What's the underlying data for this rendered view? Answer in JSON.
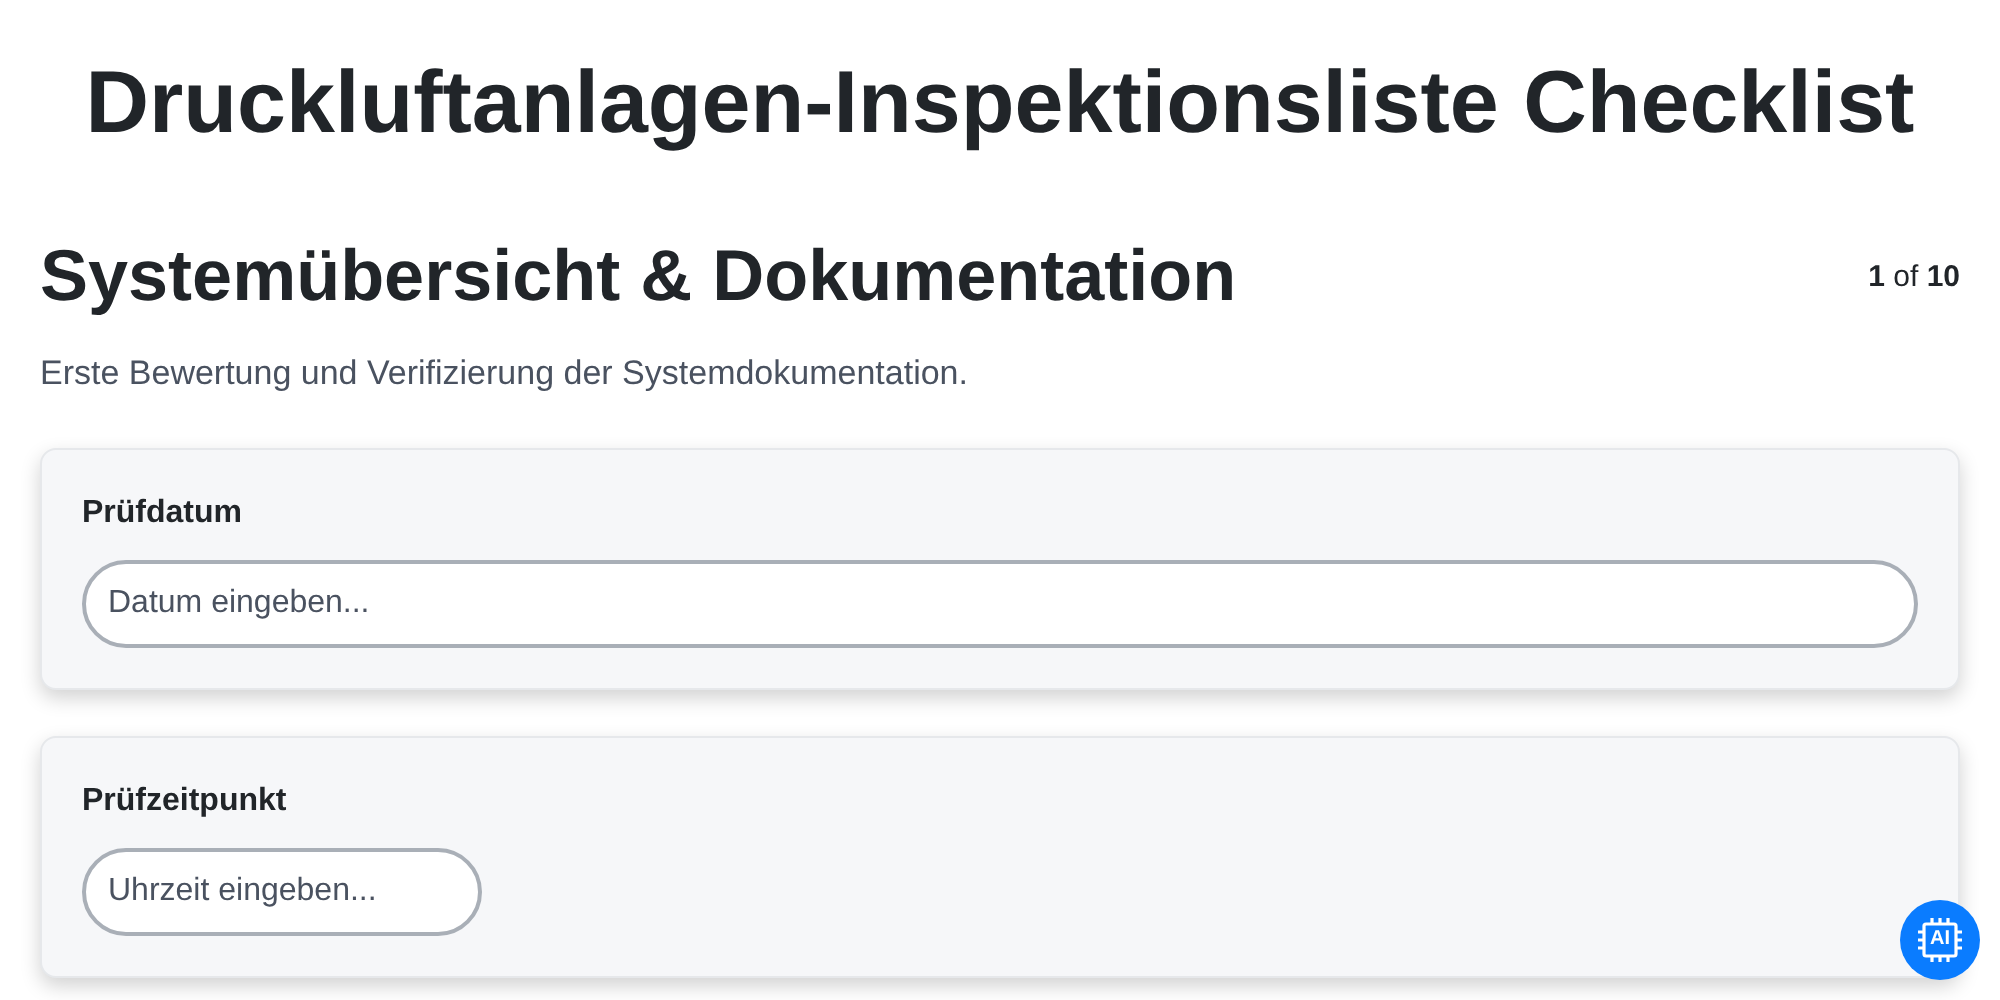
{
  "title": "Druckluftanlagen-Inspektionsliste Checklist",
  "section": {
    "heading": "Systemübersicht & Dokumentation",
    "pagination": "**1** of **10**",
    "description": "Erste Bewertung und Verifizierung der Systemdokumentation."
  },
  "fields": [
    {
      "kind": "date",
      "label": "Prüfdatum",
      "placeholder": "Datum eingeben..."
    },
    {
      "kind": "time",
      "label": "Prüfzeitpunkt",
      "placeholder": "Uhrzeit eingeben..."
    }
  ],
  "ai_button": {
    "label": "AI"
  }
}
